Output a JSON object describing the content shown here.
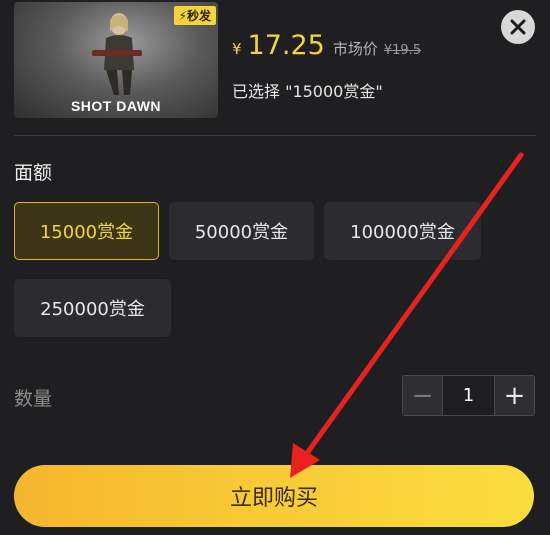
{
  "product": {
    "game_title": "SHOT DAWN",
    "badge": "⚡秒发",
    "price_symbol": "¥",
    "price": "17.25",
    "market_label": "市场价",
    "market_symbol": "¥",
    "market_price": "19.5",
    "selected_text": "已选择 \"15000赏金\""
  },
  "amount_section": {
    "title": "面额",
    "options": [
      {
        "label": "15000赏金",
        "selected": true
      },
      {
        "label": "50000赏金",
        "selected": false
      },
      {
        "label": "100000赏金",
        "selected": false
      },
      {
        "label": "250000赏金",
        "selected": false
      }
    ]
  },
  "quantity": {
    "label": "数量",
    "value": "1",
    "minus_symbol": "−",
    "plus_symbol": "+"
  },
  "buy_button": {
    "label": "立即购买"
  },
  "icons": {
    "close": "close-icon",
    "arrow": "red-arrow-annotation"
  },
  "colors": {
    "accent": "#f5d33a",
    "background": "#1f1f22",
    "arrow": "#e8221e"
  }
}
